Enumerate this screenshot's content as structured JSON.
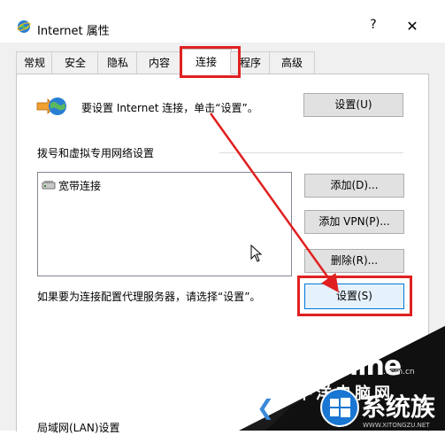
{
  "window": {
    "title": "Internet 属性",
    "help": "?",
    "close": "✕"
  },
  "tabs": [
    "常规",
    "安全",
    "隐私",
    "内容",
    "连接",
    "程序",
    "高级"
  ],
  "active_tab": "连接",
  "connection": {
    "intro": "要设置 Internet 连接，单击“设置”。",
    "setup_button": "设置(U)",
    "dialup_section": "拨号和虚拟专用网络设置",
    "dialup_items": [
      "宽带连接"
    ],
    "add_button": "添加(D)...",
    "add_vpn_button": "添加 VPN(P)...",
    "remove_button": "删除(R)...",
    "proxy_text": "如果要为连接配置代理服务器，请选择“设置”。",
    "settings_button": "设置(S)",
    "lan_section": "局域网(LAN)设置"
  },
  "watermark": {
    "brand": "PConline",
    "domain": ".com.cn",
    "cn_name": "太平洋电脑网",
    "site2": "系统族",
    "site2_domain": "WWW.XITONGZU.NET"
  },
  "colors": {
    "accent_red": "#e02020",
    "dialog_bg": "#f0f0f0",
    "button_bg": "#e1e1e1"
  }
}
